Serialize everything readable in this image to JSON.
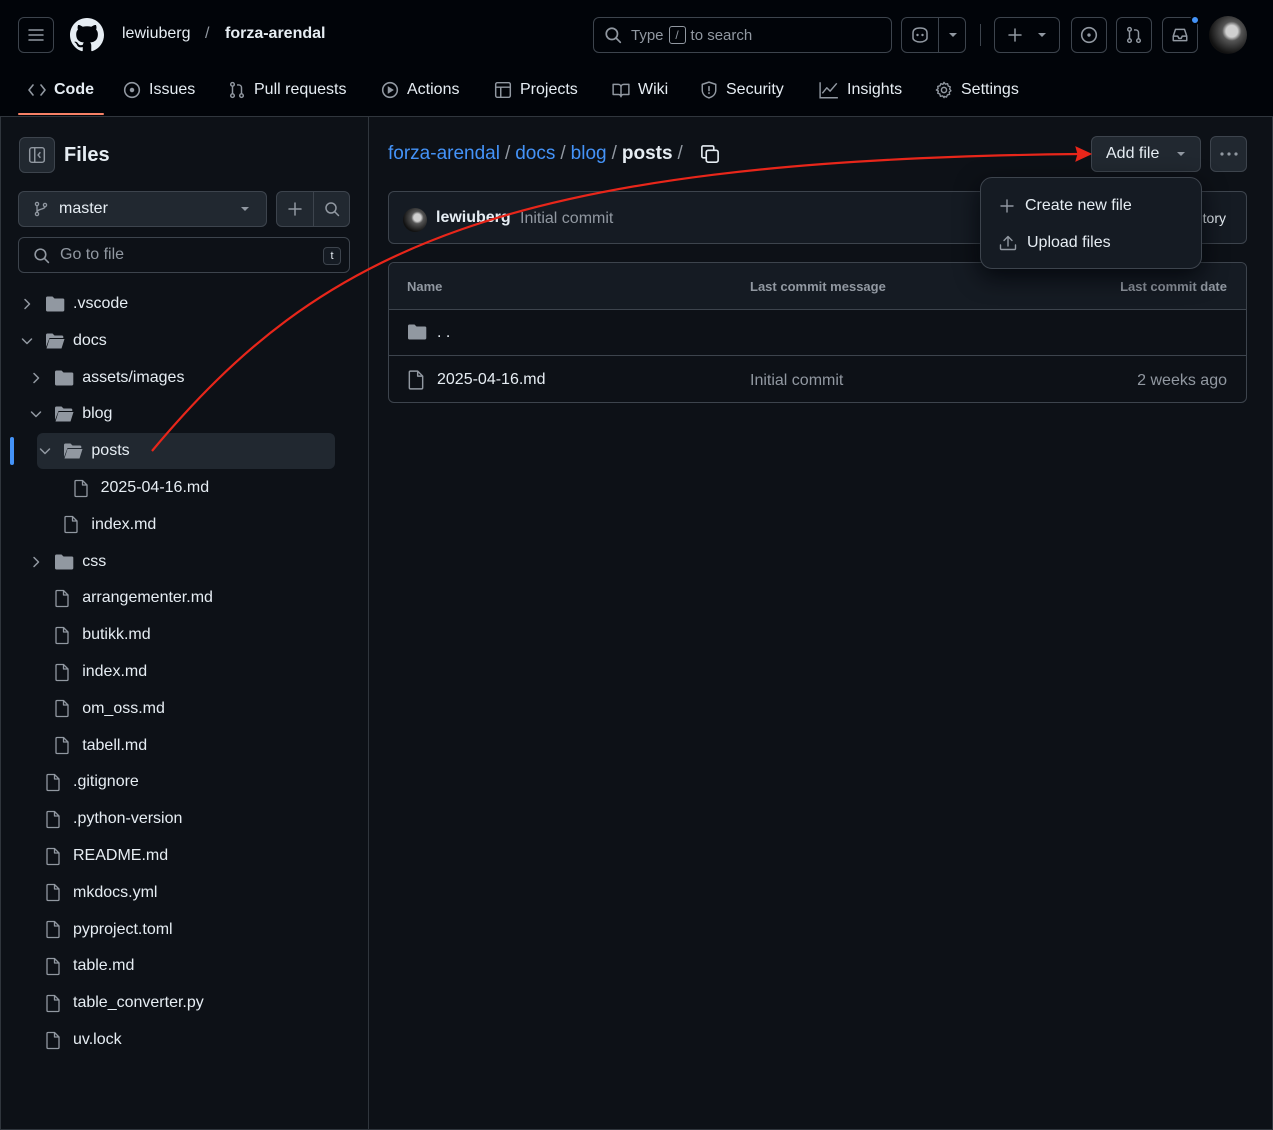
{
  "header": {
    "owner": "lewiuberg",
    "separator": "/",
    "repo": "forza-arendal",
    "search_prefix": "Type",
    "search_key": "/",
    "search_suffix": "to search"
  },
  "nav": {
    "tabs": [
      {
        "label": "Code",
        "icon": "code-icon"
      },
      {
        "label": "Issues",
        "icon": "issue-icon"
      },
      {
        "label": "Pull requests",
        "icon": "pull-request-icon"
      },
      {
        "label": "Actions",
        "icon": "play-icon"
      },
      {
        "label": "Projects",
        "icon": "table-icon"
      },
      {
        "label": "Wiki",
        "icon": "book-icon"
      },
      {
        "label": "Security",
        "icon": "shield-icon"
      },
      {
        "label": "Insights",
        "icon": "graph-icon"
      },
      {
        "label": "Settings",
        "icon": "gear-icon"
      }
    ]
  },
  "sidebar": {
    "title": "Files",
    "branch": "master",
    "goto_placeholder": "Go to file",
    "goto_key": "t",
    "tree": [
      {
        "label": ".vscode",
        "type": "folder",
        "expanded": false
      },
      {
        "label": "docs",
        "type": "folder",
        "expanded": true
      },
      {
        "label": "assets/images",
        "type": "folder",
        "expanded": false
      },
      {
        "label": "blog",
        "type": "folder",
        "expanded": true
      },
      {
        "label": "posts",
        "type": "folder",
        "expanded": true,
        "selected": true
      },
      {
        "label": "2025-04-16.md",
        "type": "file"
      },
      {
        "label": "index.md",
        "type": "file"
      },
      {
        "label": "css",
        "type": "folder",
        "expanded": false
      },
      {
        "label": "arrangementer.md",
        "type": "file"
      },
      {
        "label": "butikk.md",
        "type": "file"
      },
      {
        "label": "index.md",
        "type": "file"
      },
      {
        "label": "om_oss.md",
        "type": "file"
      },
      {
        "label": "tabell.md",
        "type": "file"
      },
      {
        "label": ".gitignore",
        "type": "file"
      },
      {
        "label": ".python-version",
        "type": "file"
      },
      {
        "label": "README.md",
        "type": "file"
      },
      {
        "label": "mkdocs.yml",
        "type": "file"
      },
      {
        "label": "pyproject.toml",
        "type": "file"
      },
      {
        "label": "table.md",
        "type": "file"
      },
      {
        "label": "table_converter.py",
        "type": "file"
      },
      {
        "label": "uv.lock",
        "type": "file"
      }
    ]
  },
  "main": {
    "breadcrumb": [
      "forza-arendal",
      "docs",
      "blog"
    ],
    "breadcrumb_current": "posts",
    "crumb_sep": "/",
    "add_file_label": "Add file",
    "commit": {
      "user": "lewiuberg",
      "message": "Initial commit",
      "history_fragment": "tory"
    },
    "table": {
      "headers": [
        "Name",
        "Last commit message",
        "Last commit date"
      ],
      "parent_label": ". .",
      "rows": [
        {
          "name": "2025-04-16.md",
          "message": "Initial commit",
          "date": "2 weeks ago"
        }
      ]
    },
    "menu": {
      "items": [
        {
          "label": "Create new file",
          "icon": "plus-icon"
        },
        {
          "label": "Upload files",
          "icon": "upload-icon"
        }
      ]
    }
  },
  "colors": {
    "accent_blue": "#4493f8",
    "annotation_arrow": "#e8261a",
    "active_tab_underline": "#f78166"
  }
}
